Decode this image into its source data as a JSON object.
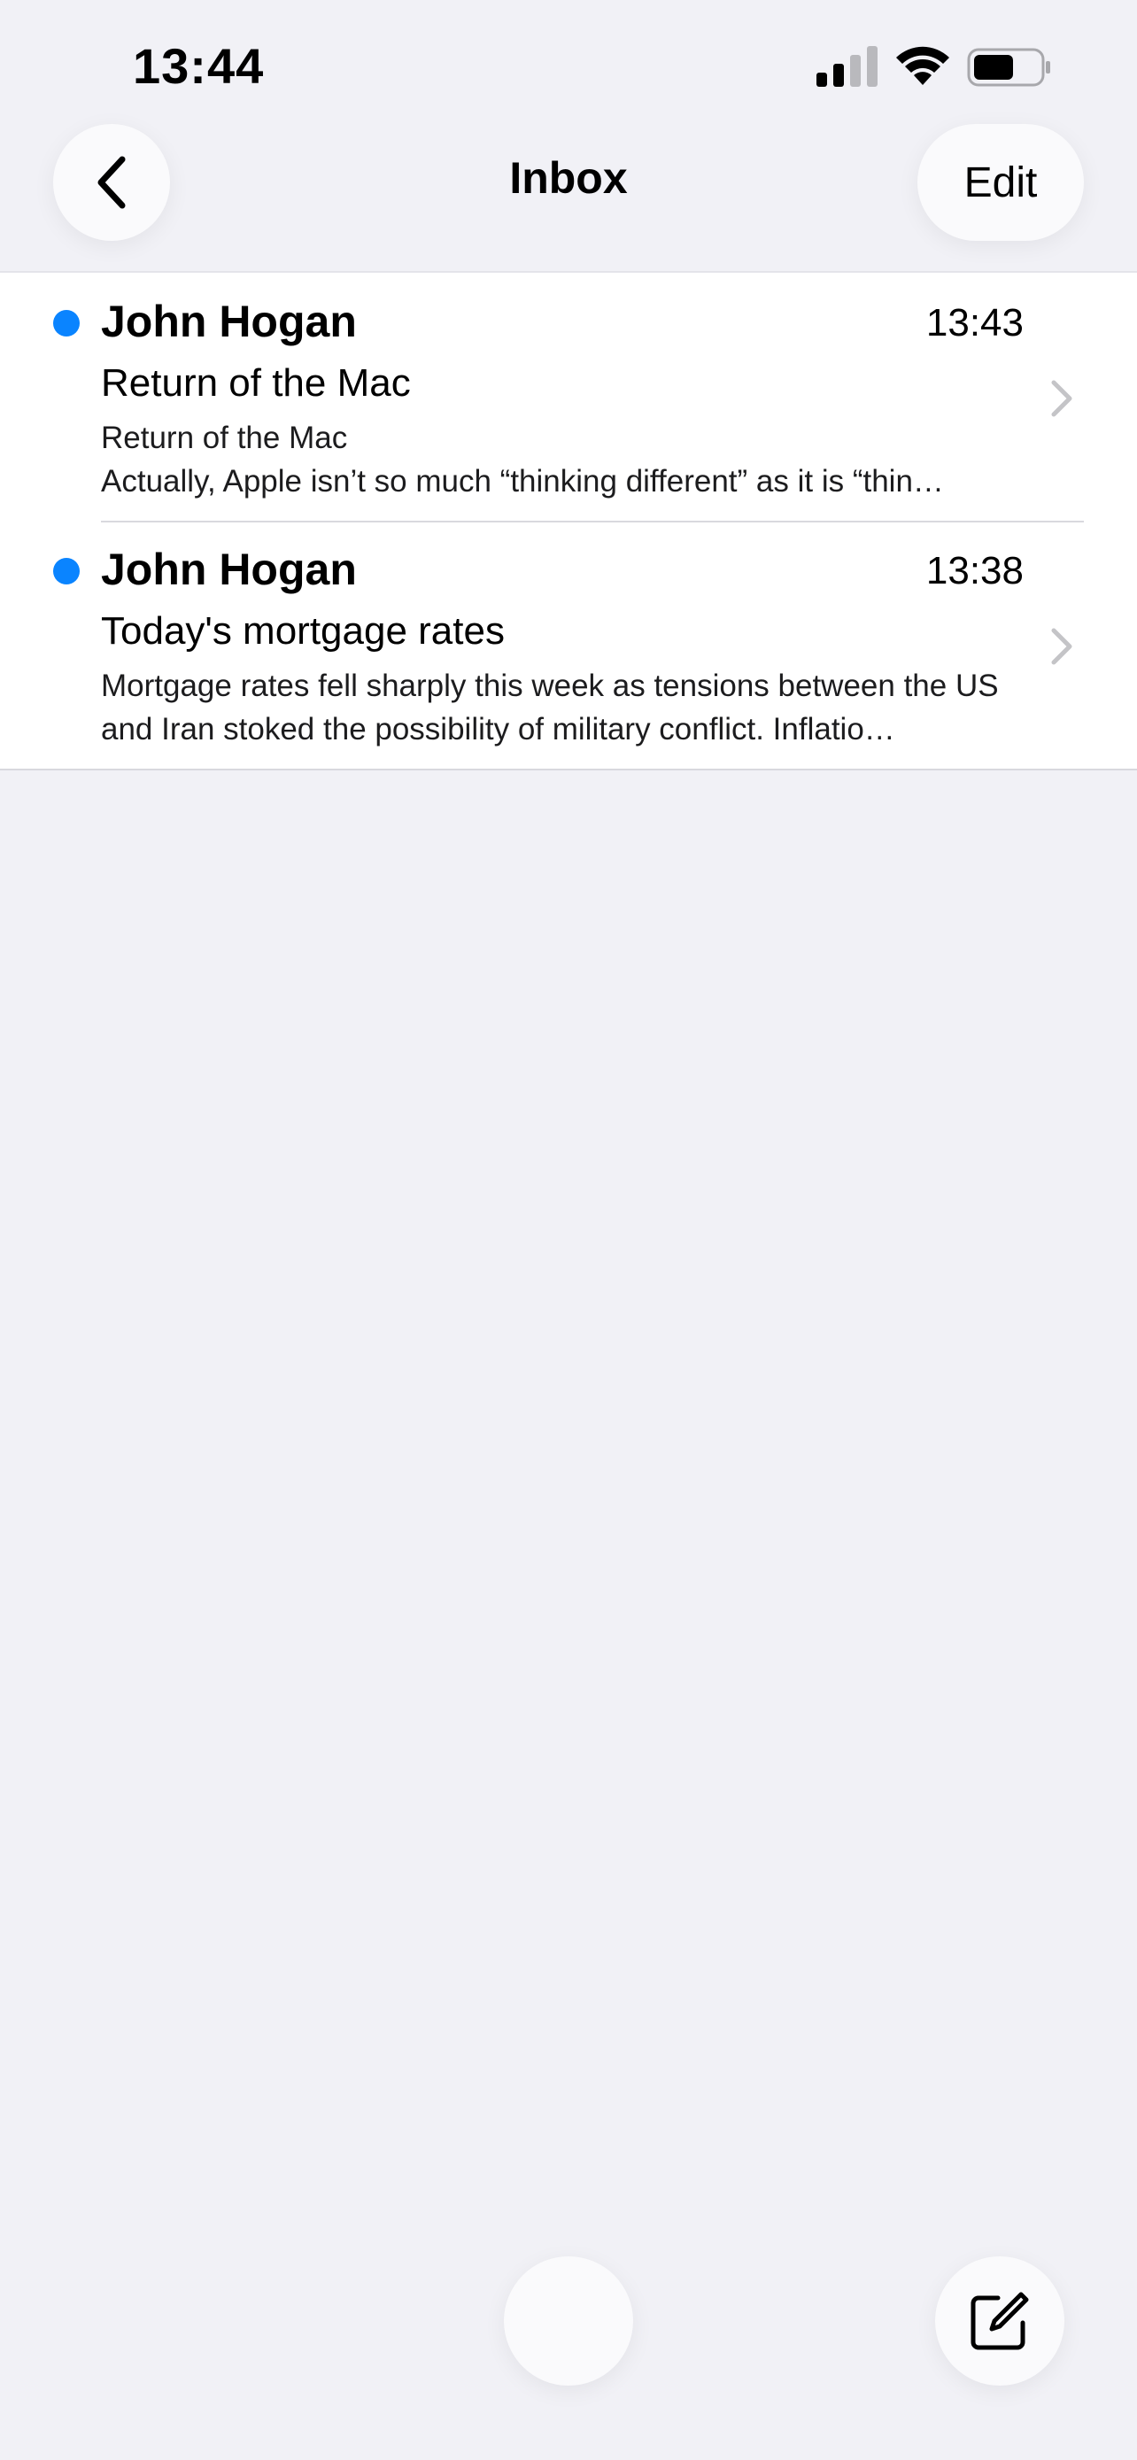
{
  "status_bar": {
    "time": "13:44"
  },
  "nav": {
    "title": "Inbox",
    "edit_label": "Edit"
  },
  "messages": [
    {
      "sender": "John Hogan",
      "time": "13:43",
      "subject": "Return of the Mac",
      "preview": "Return of the Mac\nActually, Apple isn’t so much “thinking different” as it is “thin…",
      "unread": true
    },
    {
      "sender": "John Hogan",
      "time": "13:38",
      "subject": "Today's mortgage rates",
      "preview": "Mortgage rates fell sharply this week as tensions between the US and Iran stoked the possibility of military conflict. Inflatio…",
      "unread": true
    }
  ],
  "colors": {
    "accent": "#0a84ff",
    "background": "#f1f1f6",
    "chevron": "#c4c4c7"
  },
  "icons": {
    "back": "chevron-left-icon",
    "compose": "compose-icon",
    "row_disclosure": "chevron-right-icon"
  }
}
